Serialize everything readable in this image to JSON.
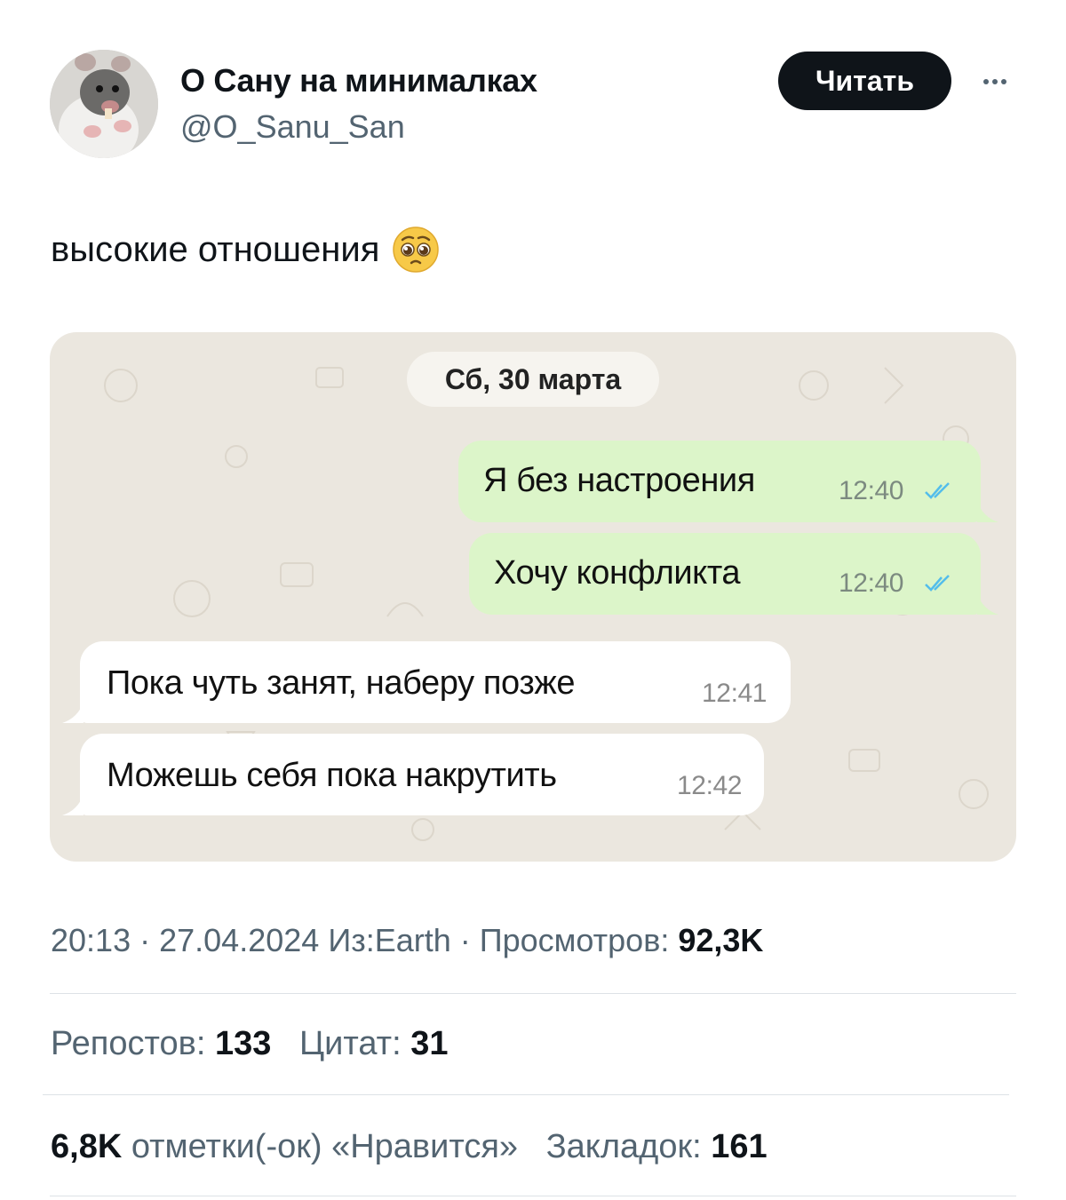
{
  "author": {
    "display_name": "О Сану на минималках",
    "handle": "@O_Sanu_San",
    "avatar_icon": "rat-avatar"
  },
  "header": {
    "follow_label": "Читать",
    "more_icon": "more-dots-icon"
  },
  "tweet": {
    "text": "высокие отношения",
    "emoji": "pleading-face-emoji"
  },
  "chat_screenshot": {
    "date_chip": "Сб, 30 марта",
    "messages": [
      {
        "direction": "outgoing",
        "text": "Я без настроения",
        "time": "12:40",
        "status_icon": "double-check-icon"
      },
      {
        "direction": "outgoing",
        "text": "Хочу конфликта",
        "time": "12:40",
        "status_icon": "double-check-icon"
      },
      {
        "direction": "incoming",
        "text": "Пока чуть занят, наберу позже",
        "time": "12:41"
      },
      {
        "direction": "incoming",
        "text": "Можешь себя пока накрутить",
        "time": "12:42"
      }
    ],
    "colors": {
      "outgoing_bubble": "#dcf5c9",
      "incoming_bubble": "#ffffff",
      "background": "#ebe7df",
      "check": "#53bdeb"
    }
  },
  "meta": {
    "time": "20:13",
    "date": "27.04.2024",
    "source": "Из:Earth",
    "views_label": "Просмотров:",
    "views_value": "92,3K"
  },
  "stats": {
    "reposts_label": "Репостов:",
    "reposts_value": "133",
    "quotes_label": "Цитат:",
    "quotes_value": "31",
    "likes_value": "6,8K",
    "likes_label": "отметки(-ок) «Нравится»",
    "bookmarks_label": "Закладок:",
    "bookmarks_value": "161"
  }
}
